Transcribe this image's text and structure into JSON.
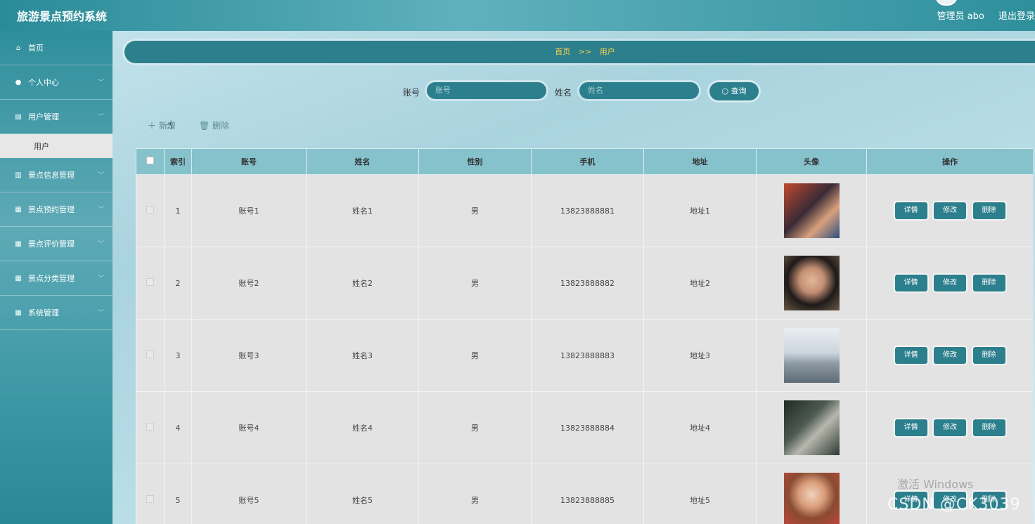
{
  "header": {
    "app_title": "旅游景点预约系统",
    "user_label": "管理员 abo",
    "logout_label": "退出登录"
  },
  "sidebar": {
    "items": [
      {
        "label": "首页",
        "icon": "home-icon"
      },
      {
        "label": "个人中心",
        "icon": "user-icon"
      },
      {
        "label": "用户管理",
        "icon": "chart-icon"
      },
      {
        "label": "景点信息管理",
        "icon": "bar-chart-icon"
      },
      {
        "label": "景点预约管理",
        "icon": "grid-icon"
      },
      {
        "label": "景点评价管理",
        "icon": "grid-icon"
      },
      {
        "label": "景点分类管理",
        "icon": "grid-icon"
      },
      {
        "label": "系统管理",
        "icon": "grid-icon"
      }
    ],
    "sub_item": "用户"
  },
  "breadcrumb": {
    "home": "首页",
    "separator": ">>",
    "current": "用户"
  },
  "search": {
    "account_label": "账号",
    "account_placeholder": "账号",
    "name_label": "姓名",
    "name_placeholder": "姓名",
    "query_label": "查询"
  },
  "actions": {
    "add_label": "新增",
    "delete_label": "删除"
  },
  "table": {
    "columns": [
      "索引",
      "账号",
      "姓名",
      "性别",
      "手机",
      "地址",
      "头像",
      "操作"
    ],
    "rows": [
      {
        "index": "1",
        "account": "账号1",
        "name": "姓名1",
        "gender": "男",
        "phone": "13823888881",
        "address": "地址1"
      },
      {
        "index": "2",
        "account": "账号2",
        "name": "姓名2",
        "gender": "男",
        "phone": "13823888882",
        "address": "地址2"
      },
      {
        "index": "3",
        "account": "账号3",
        "name": "姓名3",
        "gender": "男",
        "phone": "13823888883",
        "address": "地址3"
      },
      {
        "index": "4",
        "account": "账号4",
        "name": "姓名4",
        "gender": "男",
        "phone": "13823888884",
        "address": "地址4"
      },
      {
        "index": "5",
        "account": "账号5",
        "name": "姓名5",
        "gender": "男",
        "phone": "13823888885",
        "address": "地址5"
      }
    ],
    "op_labels": {
      "detail": "详情",
      "edit": "修改",
      "delete": "删除"
    }
  },
  "overlay": {
    "windows_text": "激活 Windows",
    "watermark": "CSDN @CK3039"
  },
  "colors": {
    "primary": "#2c7f8c",
    "header_bg": "#4fa3af",
    "breadcrumb_text": "#f7d24a",
    "table_header": "#86c2cc"
  }
}
